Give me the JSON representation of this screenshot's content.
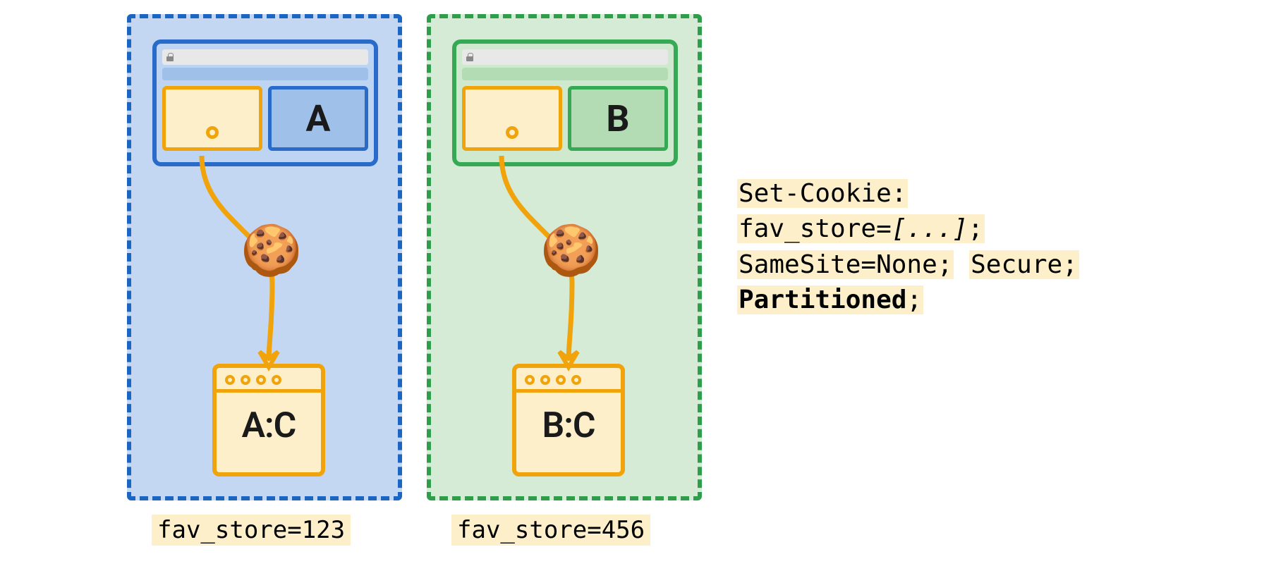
{
  "partitions": {
    "a": {
      "browser_label": "A",
      "storage_label": "A:C",
      "caption": "fav_store=123"
    },
    "b": {
      "browser_label": "B",
      "storage_label": "B:C",
      "caption": "fav_store=456"
    }
  },
  "code": {
    "line1": "Set-Cookie:",
    "line2_a": "fav_store=",
    "line2_b": "[...]",
    "line2_c": ";",
    "line3_a": "SameSite=None;",
    "line3_b": "Secure;",
    "line4_a": "Partitioned",
    "line4_b": ";"
  },
  "icons": {
    "cookie": "🍪"
  }
}
